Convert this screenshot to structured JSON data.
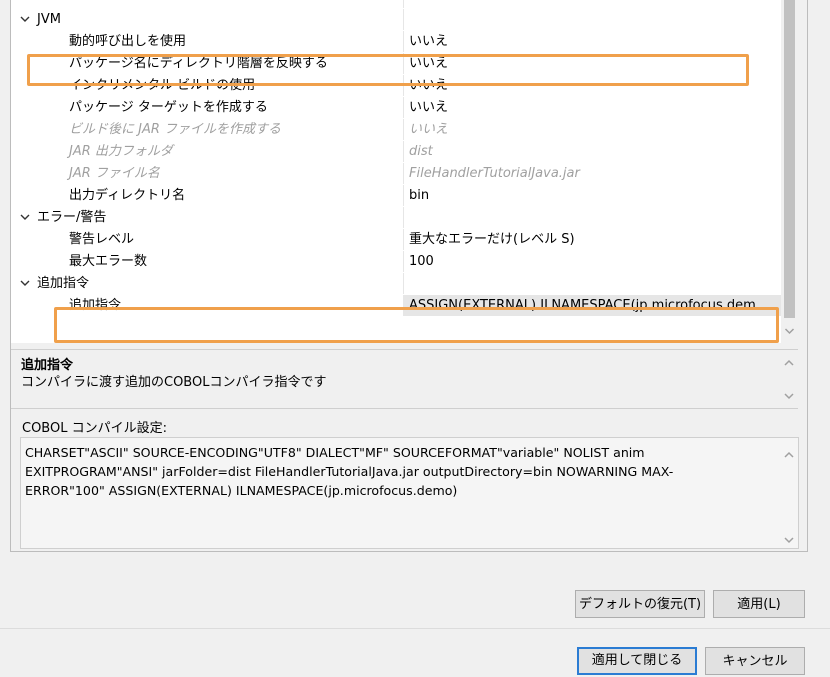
{
  "rows": [
    {
      "type": "cat",
      "label": "JVM"
    },
    {
      "type": "prop",
      "label": "動的呼び出しを使用",
      "value": "いいえ"
    },
    {
      "type": "prop",
      "label": "パッケージ名にディレクトリ階層を反映する",
      "value": "いいえ"
    },
    {
      "type": "prop",
      "label": "インクリメンタル ビルドの使用",
      "value": "いいえ"
    },
    {
      "type": "prop",
      "label": "パッケージ ターゲットを作成する",
      "value": "いいえ"
    },
    {
      "type": "prop",
      "label": "ビルド後に JAR ファイルを作成する",
      "value": "いいえ",
      "disabled": true
    },
    {
      "type": "prop",
      "label": "JAR 出力フォルダ",
      "value": "dist",
      "disabled": true
    },
    {
      "type": "prop",
      "label": "JAR ファイル名",
      "value": "FileHandlerTutorialJava.jar",
      "disabled": true
    },
    {
      "type": "prop",
      "label": "出力ディレクトリ名",
      "value": "bin"
    },
    {
      "type": "cat",
      "label": "エラー/警告"
    },
    {
      "type": "prop",
      "label": "警告レベル",
      "value": "重大なエラーだけ(レベル S)"
    },
    {
      "type": "prop",
      "label": "最大エラー数",
      "value": "100"
    },
    {
      "type": "cat",
      "label": "追加指令"
    },
    {
      "type": "prop",
      "label": "追加指令",
      "value": "ASSIGN(EXTERNAL) ILNAMESPACE(jp.microfocus.dem",
      "selected": true
    }
  ],
  "description": {
    "title": "追加指令",
    "text": "コンパイラに渡す追加のCOBOLコンパイラ指令です"
  },
  "settings": {
    "label": "COBOL コンパイル設定:",
    "text": "CHARSET\"ASCII\" SOURCE-ENCODING\"UTF8\" DIALECT\"MF\" SOURCEFORMAT\"variable\" NOLIST anim\nEXITPROGRAM\"ANSI\" jarFolder=dist FileHandlerTutorialJava.jar outputDirectory=bin NOWARNING MAX-\nERROR\"100\" ASSIGN(EXTERNAL) ILNAMESPACE(jp.microfocus.demo)"
  },
  "buttons": {
    "restore_defaults": "デフォルトの復元(T)",
    "apply": "適用(L)",
    "apply_close": "適用して閉じる",
    "cancel": "キャンセル"
  },
  "colors": {
    "highlight": "#f0a04b",
    "default_button_border": "#2b7cd3",
    "selected_value_bg": "#e6e6e6"
  }
}
